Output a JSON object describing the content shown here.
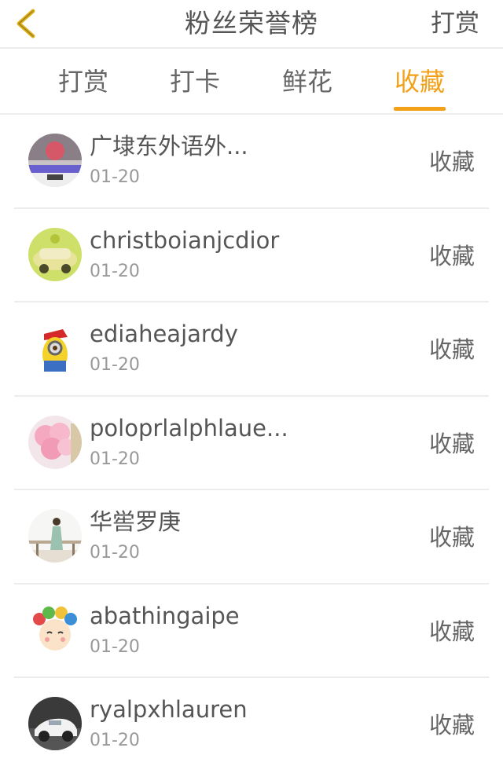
{
  "header": {
    "title": "粉丝荣誉榜",
    "action_label": "打赏",
    "back_icon": "chevron-left-icon",
    "accent_color": "#f4a11a"
  },
  "tabs": [
    {
      "label": "打赏",
      "active": false
    },
    {
      "label": "打卡",
      "active": false
    },
    {
      "label": "鲜花",
      "active": false
    },
    {
      "label": "收藏",
      "active": true
    }
  ],
  "fans": [
    {
      "name": "广埭东外语外...",
      "date": "01-20",
      "type": "收藏",
      "avatar": "photo-avatar"
    },
    {
      "name": "christboianjcdior",
      "date": "01-20",
      "type": "收藏",
      "avatar": "car-avatar"
    },
    {
      "name": "ediaheajardy",
      "date": "01-20",
      "type": "收藏",
      "avatar": "minion-avatar"
    },
    {
      "name": "poloprlalphlaue...",
      "date": "01-20",
      "type": "收藏",
      "avatar": "balloon-avatar"
    },
    {
      "name": "华喾罗庚",
      "date": "01-20",
      "type": "收藏",
      "avatar": "girl-avatar"
    },
    {
      "name": "abathingaipe",
      "date": "01-20",
      "type": "收藏",
      "avatar": "cartoon-avatar"
    },
    {
      "name": "ryalpxhlauren",
      "date": "01-20",
      "type": "收藏",
      "avatar": "white-car-avatar"
    }
  ]
}
